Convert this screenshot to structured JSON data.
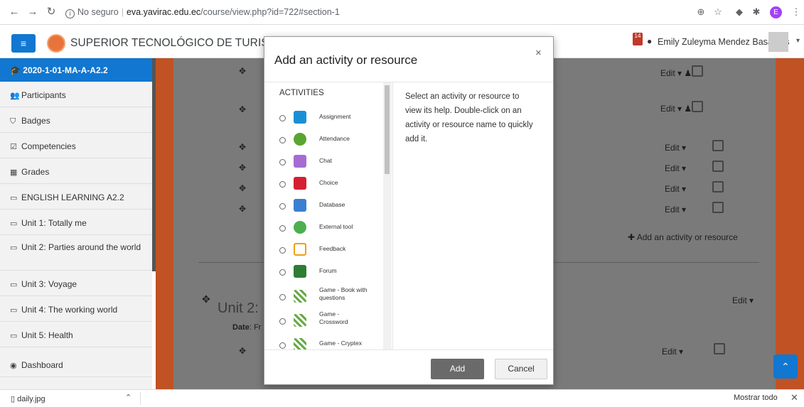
{
  "browser": {
    "not_secure": "No seguro",
    "host": "eva.yavirac.edu.ec",
    "path": "/course/view.php?id=722#section-1"
  },
  "navbar": {
    "site_title": "SUPERIOR TECNOLÓGICO DE TURISMO Y",
    "notification_count": "14",
    "user_name": "Emily Zuleyma Mendez Basantes",
    "profile_initial": "E"
  },
  "sidebar": {
    "course": "2020-1-01-MA-A-A2.2",
    "items": [
      {
        "label": "Participants"
      },
      {
        "label": "Badges"
      },
      {
        "label": "Competencies"
      },
      {
        "label": "Grades"
      },
      {
        "label": "ENGLISH LEARNING A2.2"
      },
      {
        "label": "Unit 1: Totally me"
      },
      {
        "label": "Unit 2: Parties around the world"
      },
      {
        "label": "Unit 3: Voyage"
      },
      {
        "label": "Unit 4: The working world"
      },
      {
        "label": "Unit 5: Health"
      },
      {
        "label": "Dashboard"
      }
    ]
  },
  "main": {
    "edit_label": "Edit",
    "add_activity": "Add an activity or resource",
    "unit_heading": "Unit 2:",
    "date_label": "Date",
    "date_value": ": Fr"
  },
  "modal": {
    "title": "Add an activity or resource",
    "heading": "ACTIVITIES",
    "help_text": "Select an activity or resource to view its help. Double-click on an activity or resource name to quickly add it.",
    "add_button": "Add",
    "cancel_button": "Cancel",
    "activities": [
      {
        "label": "Assignment",
        "color": "#1a8fd6"
      },
      {
        "label": "Attendance",
        "color": "#5aa532"
      },
      {
        "label": "Chat",
        "color": "#a66bd3"
      },
      {
        "label": "Choice",
        "color": "#d42030"
      },
      {
        "label": "Database",
        "color": "#3a7fd0"
      },
      {
        "label": "External tool",
        "color": "#4caf50"
      },
      {
        "label": "Feedback",
        "color": "#f39c12"
      },
      {
        "label": "Forum",
        "color": "#2e7d32"
      },
      {
        "label": "Game - Book with questions",
        "color": "#66aa44"
      },
      {
        "label": "Game - Crossword",
        "color": "#66aa44"
      },
      {
        "label": "Game - Cryptex",
        "color": "#66aa44"
      }
    ]
  },
  "downloads": {
    "file": "daily.jpg",
    "show_all": "Mostrar todo"
  }
}
